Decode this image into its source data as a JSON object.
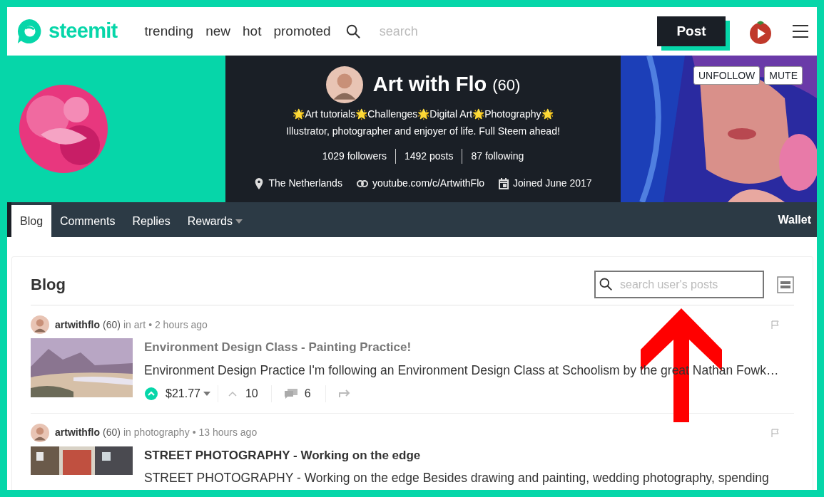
{
  "header": {
    "logo": "steemit",
    "nav": [
      "trending",
      "new",
      "hot",
      "promoted"
    ],
    "search": {
      "placeholder": "search"
    },
    "post_button": "Post"
  },
  "profile": {
    "name": "Art with Flo",
    "reputation": "(60)",
    "tagline": "🌟Art tutorials🌟Challenges🌟Digital Art🌟Photography🌟",
    "about": "Illustrator, photographer and enjoyer of life. Full Steem ahead!",
    "stats": [
      "1029 followers",
      "1492 posts",
      "87 following"
    ],
    "location": "The Netherlands",
    "website": "youtube.com/c/ArtwithFlo",
    "joined": "Joined June 2017",
    "buttons": [
      "UNFOLLOW",
      "MUTE"
    ]
  },
  "tabs": [
    {
      "label": "Blog",
      "selected": true,
      "dropdown": false
    },
    {
      "label": "Comments",
      "selected": false,
      "dropdown": false
    },
    {
      "label": "Replies",
      "selected": false,
      "dropdown": false
    },
    {
      "label": "Rewards",
      "selected": false,
      "dropdown": true
    }
  ],
  "wallet_link": "Wallet",
  "blog": {
    "title": "Blog",
    "search": {
      "placeholder": "search user's posts"
    },
    "posts": [
      {
        "author": "artwithflo",
        "reputation": "(60)",
        "category_prefix": "in",
        "category": "art",
        "time": "• 2 hours ago",
        "title": "Environment Design Class - Painting Practice!",
        "visited": true,
        "description": "Environment Design Practice I'm following an Environment Design Class at Schoolism by the great Nathan Fowk…",
        "payout": "$21.77",
        "votes": "10",
        "comments": "6"
      },
      {
        "author": "artwithflo",
        "reputation": "(60)",
        "category_prefix": "in",
        "category": "photography",
        "time": "• 13 hours ago",
        "title": "STREET PHOTOGRAPHY - Working on the edge",
        "visited": false,
        "description": "STREET PHOTOGRAPHY - Working on the edge Besides drawing and painting, wedding photography, spending"
      }
    ]
  }
}
